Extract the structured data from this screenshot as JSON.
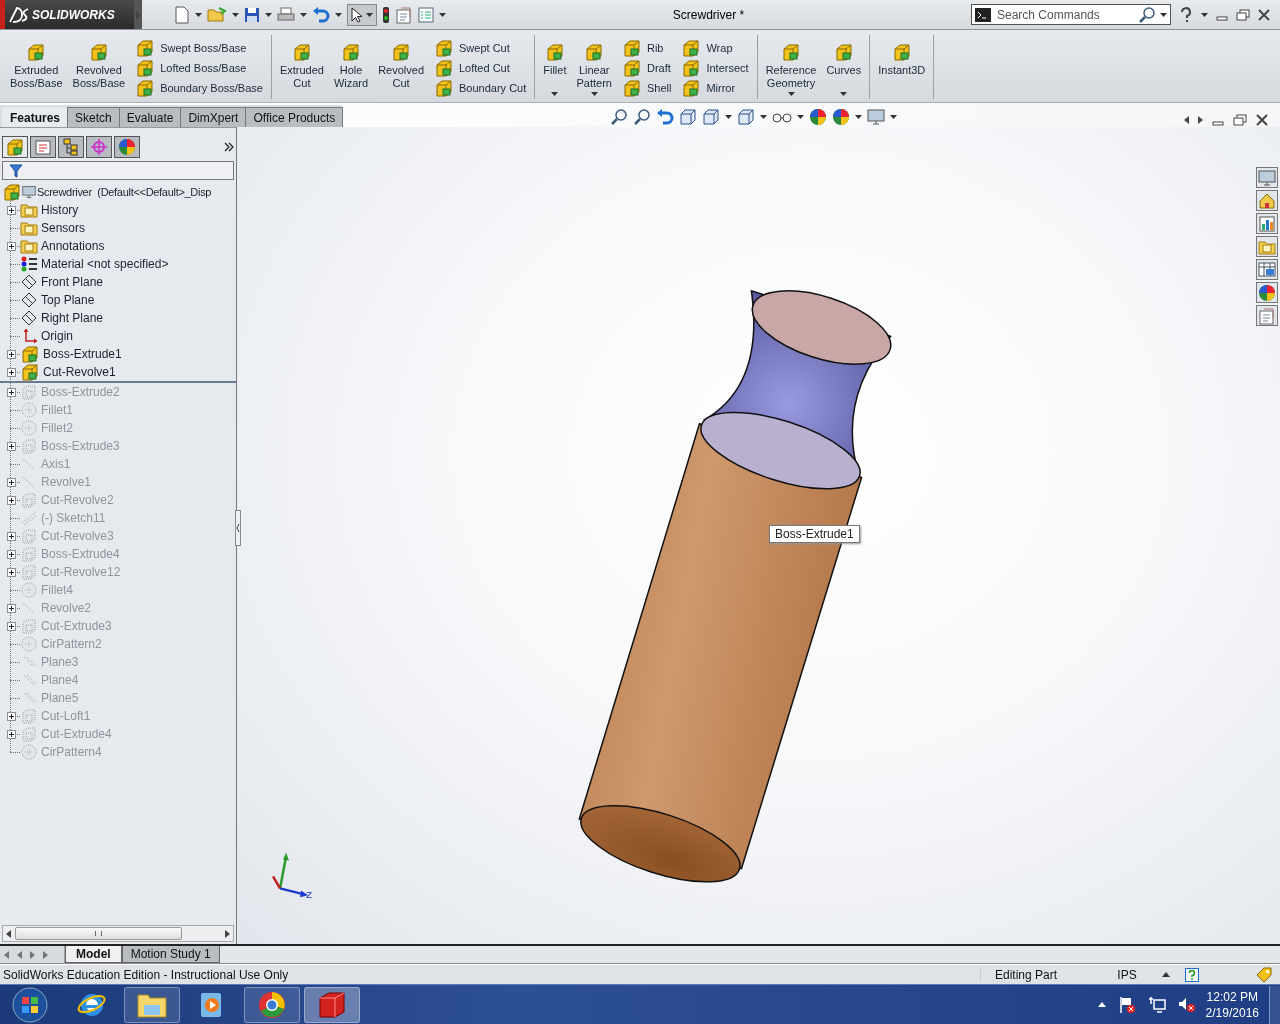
{
  "title_bar": {
    "logo": "SOLIDWORKS",
    "title": "Screwdriver *",
    "search": {
      "placeholder": "Search Commands"
    }
  },
  "ribbon": {
    "groups": [
      {
        "entries": [
          {
            "kind": "large",
            "label": "Extruded Boss/Base",
            "dropdown": false
          },
          {
            "kind": "large",
            "label": "Revolved Boss/Base",
            "dropdown": false
          },
          {
            "kind": "stack",
            "items": [
              "Swept Boss/Base",
              "Lofted Boss/Base",
              "Boundary Boss/Base"
            ]
          }
        ]
      },
      {
        "entries": [
          {
            "kind": "large",
            "label": "Extruded Cut",
            "dropdown": false
          },
          {
            "kind": "large",
            "label": "Hole Wizard",
            "dropdown": false
          },
          {
            "kind": "large",
            "label": "Revolved Cut",
            "dropdown": false
          },
          {
            "kind": "stack",
            "items": [
              "Swept Cut",
              "Lofted Cut",
              "Boundary Cut"
            ]
          }
        ]
      },
      {
        "entries": [
          {
            "kind": "large",
            "label": "Fillet",
            "dropdown": true
          },
          {
            "kind": "large",
            "label": "Linear Pattern",
            "dropdown": true
          },
          {
            "kind": "stack",
            "items": [
              "Rib",
              "Draft",
              "Shell"
            ]
          },
          {
            "kind": "stack",
            "items": [
              "Wrap",
              "Intersect",
              "Mirror"
            ]
          }
        ]
      },
      {
        "entries": [
          {
            "kind": "large",
            "label": "Reference Geometry",
            "dropdown": true
          },
          {
            "kind": "large",
            "label": "Curves",
            "dropdown": true
          }
        ]
      },
      {
        "entries": [
          {
            "kind": "large",
            "label": "Instant3D",
            "dropdown": false
          }
        ]
      }
    ]
  },
  "command_tabs": [
    {
      "label": "Features",
      "selected": true
    },
    {
      "label": "Sketch",
      "selected": false
    },
    {
      "label": "Evaluate",
      "selected": false
    },
    {
      "label": "DimXpert",
      "selected": false
    },
    {
      "label": "Office Products",
      "selected": false
    }
  ],
  "feature_tree": {
    "root": "Screwdriver  (Default<<Default>_Disp",
    "items": [
      {
        "label": "History",
        "kind": "folder",
        "expandable": true,
        "rolled_back": false
      },
      {
        "label": "Sensors",
        "kind": "folder",
        "expandable": false,
        "rolled_back": false
      },
      {
        "label": "Annotations",
        "kind": "folder",
        "expandable": true,
        "rolled_back": false
      },
      {
        "label": "Material <not specified>",
        "kind": "material",
        "expandable": false,
        "rolled_back": false
      },
      {
        "label": "Front Plane",
        "kind": "plane",
        "expandable": false,
        "rolled_back": false
      },
      {
        "label": "Top Plane",
        "kind": "plane",
        "expandable": false,
        "rolled_back": false
      },
      {
        "label": "Right Plane",
        "kind": "plane",
        "expandable": false,
        "rolled_back": false
      },
      {
        "label": "Origin",
        "kind": "origin",
        "expandable": false,
        "rolled_back": false
      },
      {
        "label": "Boss-Extrude1",
        "kind": "feature",
        "expandable": true,
        "rolled_back": false
      },
      {
        "label": "Cut-Revolve1",
        "kind": "feature",
        "expandable": true,
        "rolled_back": false
      },
      {
        "label": "Boss-Extrude2",
        "kind": "feature",
        "expandable": true,
        "rolled_back": true
      },
      {
        "label": "Fillet1",
        "kind": "fillet",
        "expandable": false,
        "rolled_back": true
      },
      {
        "label": "Fillet2",
        "kind": "fillet",
        "expandable": false,
        "rolled_back": true
      },
      {
        "label": "Boss-Extrude3",
        "kind": "feature",
        "expandable": true,
        "rolled_back": true
      },
      {
        "label": "Axis1",
        "kind": "axis",
        "expandable": false,
        "rolled_back": true
      },
      {
        "label": "Revolve1",
        "kind": "axis",
        "expandable": true,
        "rolled_back": true
      },
      {
        "label": "Cut-Revolve2",
        "kind": "feature",
        "expandable": true,
        "rolled_back": true
      },
      {
        "label": "(-) Sketch11",
        "kind": "sketch",
        "expandable": false,
        "rolled_back": true
      },
      {
        "label": "Cut-Revolve3",
        "kind": "feature",
        "expandable": true,
        "rolled_back": true
      },
      {
        "label": "Boss-Extrude4",
        "kind": "feature",
        "expandable": true,
        "rolled_back": true
      },
      {
        "label": "Cut-Revolve12",
        "kind": "feature",
        "expandable": true,
        "rolled_back": true
      },
      {
        "label": "Fillet4",
        "kind": "fillet",
        "expandable": false,
        "rolled_back": true
      },
      {
        "label": "Revolve2",
        "kind": "axis",
        "expandable": true,
        "rolled_back": true
      },
      {
        "label": "Cut-Extrude3",
        "kind": "feature",
        "expandable": true,
        "rolled_back": true
      },
      {
        "label": "CirPattern2",
        "kind": "pattern",
        "expandable": false,
        "rolled_back": true
      },
      {
        "label": "Plane3",
        "kind": "plane",
        "expandable": false,
        "rolled_back": true
      },
      {
        "label": "Plane4",
        "kind": "plane",
        "expandable": false,
        "rolled_back": true
      },
      {
        "label": "Plane5",
        "kind": "plane",
        "expandable": false,
        "rolled_back": true
      },
      {
        "label": "Cut-Loft1",
        "kind": "feature",
        "expandable": true,
        "rolled_back": true
      },
      {
        "label": "Cut-Extrude4",
        "kind": "feature",
        "expandable": true,
        "rolled_back": true
      },
      {
        "label": "CirPattern4",
        "kind": "pattern",
        "expandable": false,
        "rolled_back": true
      }
    ]
  },
  "viewport": {
    "tooltip": "Boss-Extrude1",
    "triad_label": "Z"
  },
  "model_tabs": [
    {
      "label": "Model",
      "selected": true
    },
    {
      "label": "Motion Study 1",
      "selected": false
    }
  ],
  "status_bar": {
    "message": "SolidWorks Education Edition - Instructional Use Only",
    "mode": "Editing Part",
    "units": "IPS"
  },
  "taskbar": {
    "time": "12:02 PM",
    "date": "2/19/2016"
  }
}
